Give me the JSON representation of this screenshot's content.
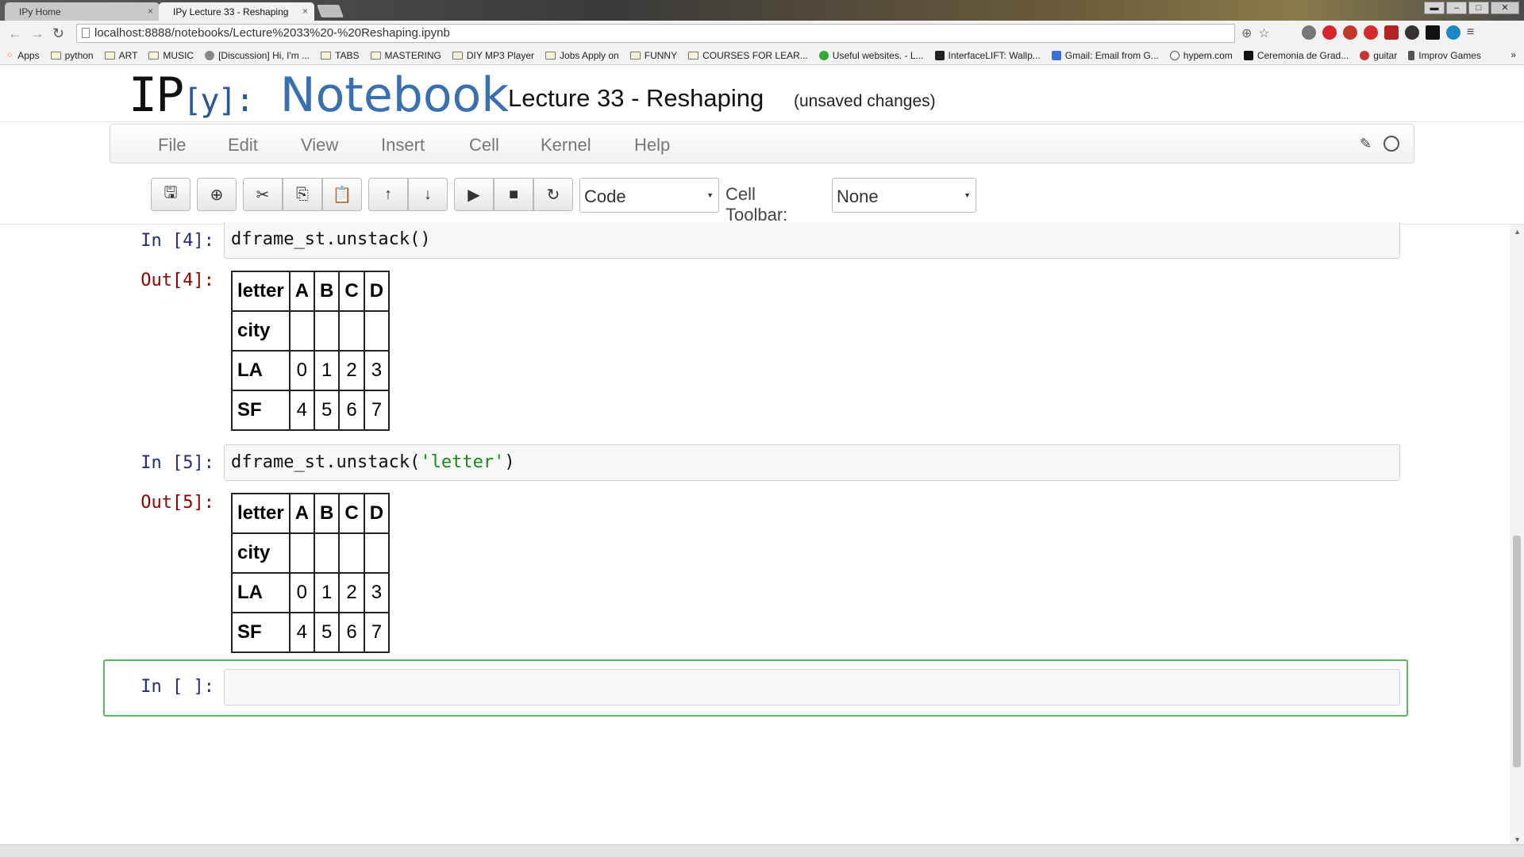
{
  "browser": {
    "tabs": [
      {
        "label": "IPy Home"
      },
      {
        "label": "IPy Lecture 33 - Reshaping"
      }
    ],
    "url": "localhost:8888/notebooks/Lecture%2033%20-%20Reshaping.ipynb",
    "bookmarks": [
      {
        "label": "Apps",
        "kind": "apps"
      },
      {
        "label": "python",
        "kind": "folder"
      },
      {
        "label": "ART",
        "kind": "folder"
      },
      {
        "label": "MUSIC",
        "kind": "folder"
      },
      {
        "label": "[Discussion] Hi, I'm ...",
        "kind": "page"
      },
      {
        "label": "TABS",
        "kind": "folder"
      },
      {
        "label": "MASTERING",
        "kind": "folder"
      },
      {
        "label": "DIY MP3 Player",
        "kind": "folder"
      },
      {
        "label": "Jobs Apply on",
        "kind": "folder"
      },
      {
        "label": "FUNNY",
        "kind": "folder"
      },
      {
        "label": "COURSES FOR LEAR...",
        "kind": "folder"
      },
      {
        "label": "Useful websites. - L...",
        "kind": "page"
      },
      {
        "label": "InterfaceLIFT: Wallp...",
        "kind": "page"
      },
      {
        "label": "Gmail: Email from G...",
        "kind": "page"
      },
      {
        "label": "hypem.com",
        "kind": "page"
      },
      {
        "label": "Ceremonia de Grad...",
        "kind": "page"
      },
      {
        "label": "guitar",
        "kind": "page"
      },
      {
        "label": "Improv Games",
        "kind": "page"
      }
    ],
    "bookmarks_more": "»"
  },
  "notebook": {
    "logo_ip": "IP",
    "logo_y": "[y]:",
    "logo_nb": "Notebook",
    "title": "Lecture 33 - Reshaping",
    "save_status": "(unsaved changes)"
  },
  "menu": {
    "items": [
      "File",
      "Edit",
      "View",
      "Insert",
      "Cell",
      "Kernel",
      "Help"
    ]
  },
  "toolbar": {
    "cell_type": "Code",
    "cell_toolbar_label": "Cell Toolbar:",
    "cell_toolbar_value": "None"
  },
  "cells": [
    {
      "in_prompt": "In [4]:",
      "code": "dframe_st.unstack()",
      "out_prompt": "Out[4]:",
      "table": {
        "columns_name": "letter",
        "columns": [
          "A",
          "B",
          "C",
          "D"
        ],
        "index_name": "city",
        "rows": [
          {
            "index": "LA",
            "values": [
              "0",
              "1",
              "2",
              "3"
            ]
          },
          {
            "index": "SF",
            "values": [
              "4",
              "5",
              "6",
              "7"
            ]
          }
        ]
      }
    },
    {
      "in_prompt": "In [5]:",
      "code_pre": "dframe_st.unstack(",
      "code_str": "'letter'",
      "code_post": ")",
      "out_prompt": "Out[5]:",
      "table": {
        "columns_name": "letter",
        "columns": [
          "A",
          "B",
          "C",
          "D"
        ],
        "index_name": "city",
        "rows": [
          {
            "index": "LA",
            "values": [
              "0",
              "1",
              "2",
              "3"
            ]
          },
          {
            "index": "SF",
            "values": [
              "4",
              "5",
              "6",
              "7"
            ]
          }
        ]
      }
    },
    {
      "in_prompt": "In [ ]:",
      "code": ""
    }
  ]
}
